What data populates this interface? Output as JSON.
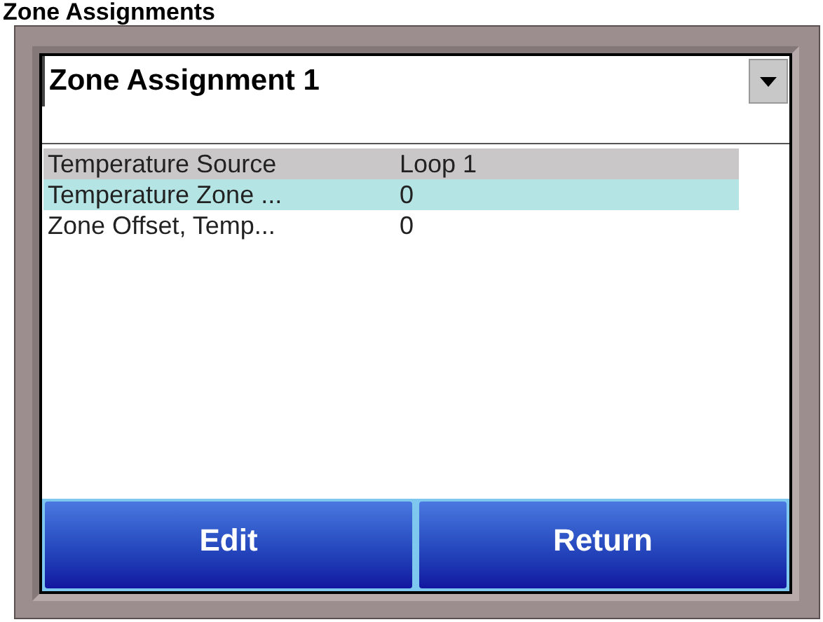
{
  "page_title": "Zone Assignments",
  "dropdown": {
    "value": "Zone Assignment 1"
  },
  "rows": [
    {
      "label": "Temperature Source",
      "value": "Loop 1",
      "selected": false,
      "focused": true
    },
    {
      "label": "Temperature Zone ...",
      "value": "0",
      "selected": true,
      "focused": false
    },
    {
      "label": "Zone Offset, Temp...",
      "value": "0",
      "selected": false,
      "focused": false
    }
  ],
  "buttons": [
    "Edit",
    "Return"
  ]
}
